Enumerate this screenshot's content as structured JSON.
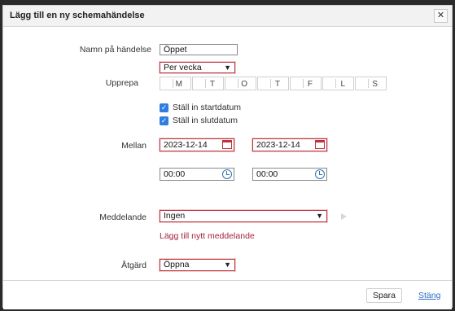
{
  "dialog": {
    "title": "Lägg till en ny schemahändelse",
    "close_glyph": "✕"
  },
  "form": {
    "name_label": "Namn på händelse",
    "name_value": "Öppet",
    "repeat_label": "Upprepa",
    "repeat_select": "Per vecka",
    "days": [
      "M",
      "T",
      "O",
      "T",
      "F",
      "L",
      "S"
    ],
    "set_start_date": "Ställ in startdatum",
    "set_end_date": "Ställ in slutdatum",
    "between_label": "Mellan",
    "start_date": "2023-12-14",
    "end_date": "2023-12-14",
    "start_time": "00:00",
    "end_time": "00:00",
    "message_label": "Meddelande",
    "message_select": "Ingen",
    "add_message_link": "Lägg till nytt meddelande",
    "action_label": "Åtgärd",
    "action_select": "Öppna"
  },
  "footer": {
    "save_label": "Spara",
    "close_label": "Stäng"
  },
  "icons": {
    "calendar": "calendar-icon",
    "clock": "clock-icon",
    "checkbox": "checkbox-icon",
    "play": "play-icon"
  },
  "colors": {
    "accent_red": "#c0323b",
    "link_blue": "#2b6cc4",
    "checkbox_blue": "#2f7de1"
  }
}
